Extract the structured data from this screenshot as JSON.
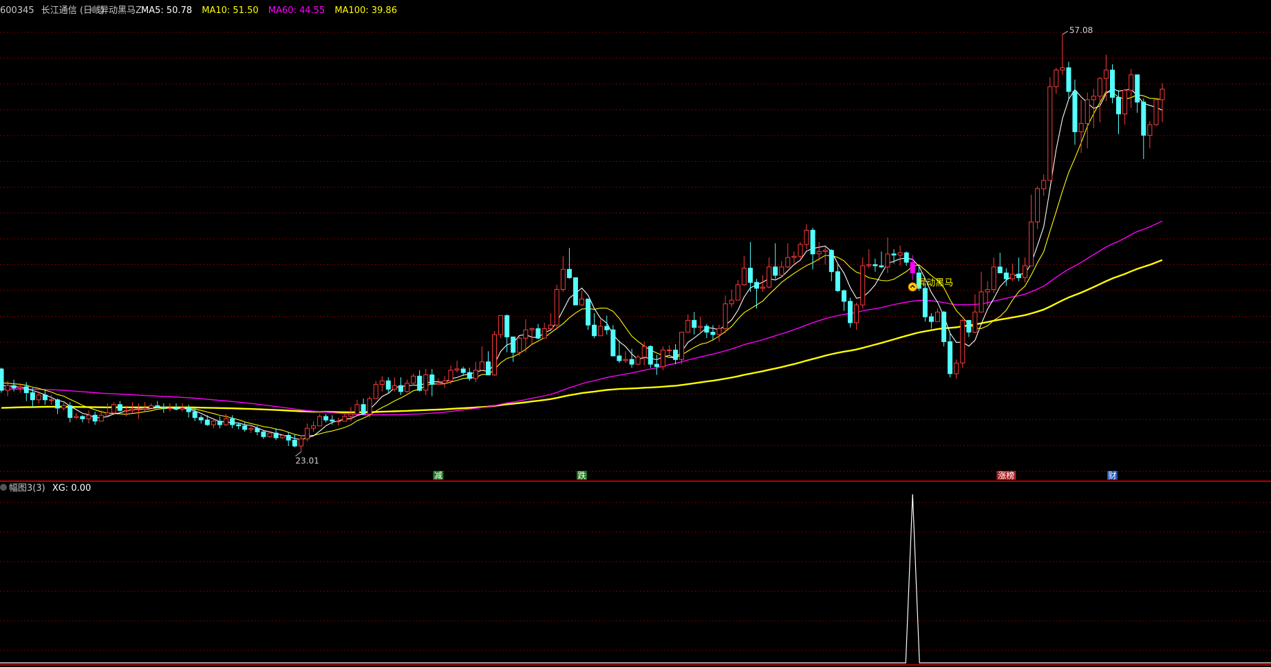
{
  "header": {
    "stock_code": "600345",
    "stock_name": "长江通信",
    "period": "(日线)",
    "indicator_name": "异动黑马Z",
    "ma_labels": [
      {
        "label": "MA5: 50.78",
        "color": "#ffffff"
      },
      {
        "label": "MA10: 51.50",
        "color": "#ffff00"
      },
      {
        "label": "MA60: 44.55",
        "color": "#ff00ff"
      },
      {
        "label": "MA100: 39.86",
        "color": "#ffff00"
      }
    ]
  },
  "sub_header": {
    "name": "幅图3(3)",
    "xg_label": "XG: 0.00"
  },
  "annotations": {
    "high_label": "57.08",
    "low_label": "23.01",
    "signal_label": "异动黑马",
    "event_markers": [
      {
        "text": "减",
        "color": "#ffffff",
        "bg": "#227722",
        "index": 70
      },
      {
        "text": "跌",
        "color": "#ffffff",
        "bg": "#227722",
        "index": 93
      },
      {
        "text": "涨榜",
        "color": "#ffffff",
        "bg": "#aa2222",
        "index": 161
      },
      {
        "text": "财",
        "color": "#ffffff",
        "bg": "#2255aa",
        "index": 178
      }
    ]
  },
  "colors": {
    "up": "#ff3c3c",
    "down": "#54ffff",
    "grid": "#7a0000",
    "frame": "#b40000",
    "ma5": "#ffffff",
    "ma10": "#ffff00",
    "ma60": "#ff00ff",
    "ma100": "#ffff00",
    "signal_bar": "#ff00ff"
  },
  "chart_data": {
    "type": "candlestick",
    "price_range": [
      19.5,
      58.5
    ],
    "signal_index": 146,
    "candles": [
      [
        28.9,
        27.1,
        29.0,
        26.9
      ],
      [
        27.1,
        27.5,
        27.9,
        26.6
      ],
      [
        27.5,
        27.3,
        28.0,
        27.0
      ],
      [
        27.3,
        27.4,
        27.7,
        26.9
      ],
      [
        27.4,
        26.9,
        27.8,
        26.2
      ],
      [
        26.9,
        26.3,
        27.3,
        25.7
      ],
      [
        26.3,
        26.7,
        27.0,
        26.0
      ],
      [
        26.7,
        26.3,
        27.1,
        25.9
      ],
      [
        26.3,
        26.3,
        26.7,
        25.9
      ],
      [
        26.3,
        25.6,
        26.4,
        25.1
      ],
      [
        25.6,
        25.8,
        26.2,
        25.4
      ],
      [
        25.8,
        24.8,
        26.1,
        24.4
      ],
      [
        24.8,
        24.9,
        25.2,
        24.7
      ],
      [
        24.9,
        24.7,
        25.0,
        24.4
      ],
      [
        24.7,
        25.0,
        25.4,
        24.3
      ],
      [
        25.0,
        24.5,
        25.3,
        24.2
      ],
      [
        24.5,
        25.0,
        25.4,
        24.5
      ],
      [
        25.0,
        25.2,
        26.0,
        25.0
      ],
      [
        25.2,
        25.9,
        26.1,
        25.0
      ],
      [
        25.9,
        25.4,
        26.2,
        25.3
      ],
      [
        25.4,
        25.4,
        25.8,
        24.9
      ],
      [
        25.4,
        25.5,
        26.1,
        25.2
      ],
      [
        25.5,
        25.5,
        26.0,
        24.7
      ],
      [
        25.5,
        25.6,
        26.1,
        25.3
      ],
      [
        25.6,
        25.8,
        26.0,
        25.6
      ],
      [
        25.8,
        25.7,
        26.2,
        25.6
      ],
      [
        25.7,
        25.6,
        26.0,
        25.2
      ],
      [
        25.6,
        25.6,
        26.0,
        25.3
      ],
      [
        25.6,
        25.5,
        26.0,
        25.4
      ],
      [
        25.5,
        25.6,
        26.0,
        25.3
      ],
      [
        25.6,
        25.3,
        25.9,
        24.8
      ],
      [
        25.3,
        24.8,
        25.6,
        24.5
      ],
      [
        24.8,
        24.6,
        25.0,
        24.3
      ],
      [
        24.6,
        24.2,
        25.0,
        24.1
      ],
      [
        24.2,
        24.5,
        24.6,
        23.9
      ],
      [
        24.5,
        24.2,
        24.9,
        23.9
      ],
      [
        24.2,
        24.7,
        25.1,
        24.1
      ],
      [
        24.7,
        24.2,
        25.0,
        23.9
      ],
      [
        24.2,
        24.1,
        24.4,
        23.8
      ],
      [
        24.1,
        23.8,
        24.4,
        23.6
      ],
      [
        23.8,
        23.9,
        24.2,
        23.5
      ],
      [
        23.9,
        23.6,
        24.1,
        23.3
      ],
      [
        23.6,
        23.2,
        23.7,
        23.0
      ],
      [
        23.2,
        23.5,
        23.7,
        23.1
      ],
      [
        23.5,
        23.1,
        23.9,
        22.9
      ],
      [
        23.1,
        23.3,
        23.4,
        23.0
      ],
      [
        23.3,
        22.9,
        23.6,
        22.4
      ],
      [
        22.9,
        22.4,
        23.4,
        22.3
      ],
      [
        22.4,
        23.0,
        23.3,
        21.9
      ],
      [
        23.0,
        23.9,
        24.3,
        22.8
      ],
      [
        23.9,
        24.1,
        24.5,
        23.6
      ],
      [
        24.1,
        24.9,
        25.1,
        24.1
      ],
      [
        24.9,
        24.6,
        25.1,
        24.4
      ],
      [
        24.6,
        24.5,
        25.0,
        24.2
      ],
      [
        24.5,
        24.5,
        24.8,
        24.1
      ],
      [
        24.5,
        24.9,
        25.1,
        24.5
      ],
      [
        24.9,
        25.1,
        25.7,
        24.5
      ],
      [
        25.1,
        25.9,
        26.3,
        25.1
      ],
      [
        25.9,
        25.1,
        26.4,
        25.0
      ],
      [
        25.1,
        26.4,
        26.6,
        24.8
      ],
      [
        26.4,
        27.6,
        27.9,
        26.4
      ],
      [
        27.6,
        27.9,
        28.3,
        27.0
      ],
      [
        27.9,
        27.2,
        28.2,
        26.9
      ],
      [
        27.2,
        27.5,
        28.2,
        27.0
      ],
      [
        27.5,
        27.0,
        28.2,
        26.7
      ],
      [
        27.0,
        27.7,
        28.0,
        26.9
      ],
      [
        27.7,
        28.3,
        28.5,
        27.5
      ],
      [
        28.3,
        27.1,
        28.8,
        27.0
      ],
      [
        27.1,
        28.4,
        28.9,
        26.7
      ],
      [
        28.4,
        27.6,
        28.9,
        26.6
      ],
      [
        27.6,
        27.7,
        28.1,
        27.6
      ],
      [
        27.7,
        27.9,
        28.3,
        27.3
      ],
      [
        27.9,
        28.8,
        29.2,
        27.6
      ],
      [
        28.8,
        28.9,
        29.6,
        28.6
      ],
      [
        28.9,
        28.6,
        29.1,
        28.3
      ],
      [
        28.6,
        28.1,
        29.0,
        27.9
      ],
      [
        28.1,
        28.8,
        29.5,
        27.8
      ],
      [
        28.8,
        29.5,
        30.8,
        28.8
      ],
      [
        29.5,
        28.4,
        30.4,
        28.4
      ],
      [
        28.4,
        31.8,
        32.1,
        28.3
      ],
      [
        31.8,
        33.4,
        33.4,
        31.5
      ],
      [
        33.4,
        31.6,
        33.5,
        30.3
      ],
      [
        31.6,
        30.3,
        31.6,
        29.5
      ],
      [
        30.3,
        31.5,
        31.6,
        30.0
      ],
      [
        31.5,
        32.2,
        33.1,
        30.3
      ],
      [
        32.2,
        32.3,
        32.4,
        31.0
      ],
      [
        32.3,
        31.5,
        32.7,
        31.4
      ],
      [
        31.5,
        32.3,
        32.8,
        31.9
      ],
      [
        32.3,
        32.6,
        33.6,
        32.5
      ],
      [
        32.6,
        35.6,
        36.0,
        32.2
      ],
      [
        35.6,
        37.3,
        38.4,
        35.4
      ],
      [
        37.3,
        36.6,
        39.1,
        36.5
      ],
      [
        36.6,
        34.3,
        36.6,
        34.3
      ],
      [
        34.3,
        34.8,
        35.5,
        34.2
      ],
      [
        34.8,
        32.6,
        34.8,
        32.2
      ],
      [
        32.6,
        31.7,
        33.6,
        31.5
      ],
      [
        31.7,
        32.5,
        33.1,
        31.7
      ],
      [
        32.5,
        32.2,
        33.4,
        31.8
      ],
      [
        32.2,
        30.0,
        32.6,
        30.0
      ],
      [
        30.0,
        29.6,
        31.3,
        29.4
      ],
      [
        29.6,
        29.7,
        30.4,
        29.4
      ],
      [
        29.7,
        29.3,
        30.6,
        29.0
      ],
      [
        29.3,
        29.9,
        30.1,
        29.2
      ],
      [
        29.9,
        30.8,
        31.2,
        29.2
      ],
      [
        30.8,
        29.3,
        30.9,
        29.0
      ],
      [
        29.3,
        29.1,
        30.1,
        28.4
      ],
      [
        29.1,
        30.5,
        30.8,
        28.8
      ],
      [
        30.5,
        30.5,
        30.9,
        30.1
      ],
      [
        30.5,
        29.7,
        31.0,
        29.3
      ],
      [
        29.7,
        32.0,
        32.0,
        29.3
      ],
      [
        32.0,
        33.0,
        33.5,
        32.0
      ],
      [
        33.0,
        32.4,
        33.7,
        31.8
      ],
      [
        32.4,
        32.5,
        33.3,
        32.0
      ],
      [
        32.5,
        32.0,
        32.7,
        31.5
      ],
      [
        32.0,
        31.8,
        32.6,
        31.3
      ],
      [
        31.8,
        32.3,
        32.6,
        31.2
      ],
      [
        32.3,
        34.4,
        35.1,
        31.9
      ],
      [
        34.4,
        34.7,
        35.6,
        34.1
      ],
      [
        34.7,
        36.0,
        36.4,
        34.7
      ],
      [
        36.0,
        37.4,
        38.4,
        35.9
      ],
      [
        37.4,
        36.2,
        39.6,
        35.4
      ],
      [
        36.2,
        35.7,
        36.5,
        34.0
      ],
      [
        35.7,
        35.8,
        36.8,
        35.4
      ],
      [
        35.8,
        37.5,
        38.3,
        35.7
      ],
      [
        37.5,
        36.8,
        39.5,
        36.5
      ],
      [
        36.8,
        37.5,
        38.0,
        36.6
      ],
      [
        37.5,
        38.3,
        39.5,
        37.4
      ],
      [
        38.3,
        38.4,
        38.8,
        37.8
      ],
      [
        38.4,
        39.4,
        39.6,
        38.2
      ],
      [
        39.4,
        40.6,
        41.1,
        39.0
      ],
      [
        40.6,
        38.6,
        40.8,
        37.3
      ],
      [
        38.6,
        38.8,
        39.6,
        38.0
      ],
      [
        38.8,
        38.9,
        39.2,
        37.7
      ],
      [
        38.9,
        37.1,
        39.0,
        36.3
      ],
      [
        37.1,
        35.5,
        37.7,
        35.4
      ],
      [
        35.5,
        34.6,
        35.6,
        33.8
      ],
      [
        34.6,
        32.8,
        34.9,
        32.4
      ],
      [
        32.8,
        34.3,
        34.5,
        32.2
      ],
      [
        34.3,
        37.6,
        38.3,
        34.0
      ],
      [
        37.6,
        37.7,
        39.0,
        37.4
      ],
      [
        37.7,
        37.6,
        38.2,
        37.1
      ],
      [
        37.6,
        37.5,
        38.8,
        37.4
      ],
      [
        37.5,
        38.6,
        40.0,
        37.0
      ],
      [
        38.6,
        38.5,
        39.0,
        37.8
      ],
      [
        38.5,
        38.7,
        39.3,
        37.6
      ],
      [
        38.7,
        37.9,
        38.8,
        37.6
      ],
      [
        37.9,
        37.0,
        38.5,
        36.4
      ],
      [
        37.0,
        35.7,
        37.5,
        35.5
      ],
      [
        35.7,
        33.3,
        36.1,
        32.9
      ],
      [
        33.3,
        32.9,
        33.6,
        32.3
      ],
      [
        32.9,
        33.7,
        34.0,
        32.9
      ],
      [
        33.7,
        31.2,
        33.8,
        30.8
      ],
      [
        31.2,
        28.5,
        31.9,
        28.2
      ],
      [
        28.5,
        29.4,
        29.7,
        28.1
      ],
      [
        29.4,
        33.0,
        33.1,
        29.0
      ],
      [
        33.0,
        32.0,
        33.0,
        31.6
      ],
      [
        32.0,
        33.7,
        35.2,
        31.9
      ],
      [
        33.7,
        35.4,
        37.1,
        33.7
      ],
      [
        35.4,
        35.6,
        36.3,
        34.2
      ],
      [
        35.6,
        37.5,
        38.3,
        35.3
      ],
      [
        37.5,
        37.0,
        38.7,
        37.0
      ],
      [
        37.0,
        36.5,
        37.4,
        35.9
      ],
      [
        36.5,
        36.9,
        37.8,
        36.3
      ],
      [
        36.9,
        36.6,
        38.3,
        36.3
      ],
      [
        36.6,
        37.6,
        38.3,
        36.2
      ],
      [
        37.6,
        41.3,
        43.6,
        37.6
      ],
      [
        41.3,
        44.1,
        44.3,
        40.7
      ],
      [
        44.1,
        44.8,
        45.3,
        43.5
      ],
      [
        44.8,
        52.7,
        53.5,
        44.8
      ],
      [
        52.7,
        54.1,
        54.3,
        52.1
      ],
      [
        54.1,
        54.3,
        57.1,
        53.7
      ],
      [
        54.3,
        52.3,
        54.8,
        51.6
      ],
      [
        52.3,
        48.9,
        53.3,
        47.8
      ],
      [
        48.9,
        49.6,
        51.6,
        47.1
      ],
      [
        49.6,
        51.6,
        52.2,
        47.5
      ],
      [
        51.6,
        51.9,
        52.5,
        49.2
      ],
      [
        51.9,
        53.4,
        53.5,
        49.7
      ],
      [
        53.4,
        54.1,
        55.4,
        51.5
      ],
      [
        54.1,
        51.8,
        54.6,
        51.3
      ],
      [
        51.8,
        50.4,
        52.4,
        48.7
      ],
      [
        50.4,
        52.4,
        52.5,
        49.5
      ],
      [
        52.4,
        53.7,
        54.2,
        50.9
      ],
      [
        53.7,
        51.4,
        53.7,
        50.5
      ],
      [
        51.4,
        48.6,
        51.7,
        46.6
      ],
      [
        48.6,
        49.5,
        49.8,
        47.5
      ],
      [
        49.5,
        51.6,
        51.7,
        49.4
      ],
      [
        51.6,
        52.5,
        53.0,
        49.7
      ]
    ],
    "sub_series": {
      "name": "XG",
      "range": [
        0,
        1
      ],
      "values_note": "0 everywhere except 1 at signal_index"
    }
  }
}
